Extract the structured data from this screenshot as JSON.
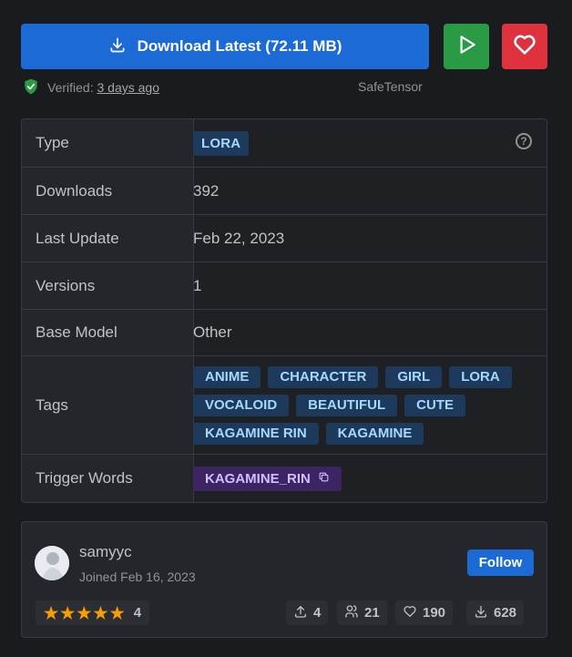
{
  "actions": {
    "download_label": "Download Latest (72.11 MB)",
    "play_icon": "play-icon",
    "like_icon": "heart-icon"
  },
  "verification": {
    "prefix": "Verified:",
    "date": "3 days ago",
    "format": "SafeTensor"
  },
  "details": {
    "type": {
      "label": "Type",
      "value": "LORA"
    },
    "downloads": {
      "label": "Downloads",
      "value": "392"
    },
    "last_update": {
      "label": "Last Update",
      "value": "Feb 22, 2023"
    },
    "versions": {
      "label": "Versions",
      "value": "1"
    },
    "base_model": {
      "label": "Base Model",
      "value": "Other"
    },
    "tags": {
      "label": "Tags",
      "values": [
        "ANIME",
        "CHARACTER",
        "GIRL",
        "LORA",
        "VOCALOID",
        "BEAUTIFUL",
        "CUTE",
        "KAGAMINE RIN",
        "KAGAMINE"
      ]
    },
    "trigger_words": {
      "label": "Trigger Words",
      "value": "KAGAMINE_RIN"
    }
  },
  "creator": {
    "username": "samyyc",
    "joined": "Joined Feb 16, 2023",
    "follow_label": "Follow",
    "rating": "4",
    "stars": 5,
    "stats": {
      "uploads": "4",
      "followers": "21",
      "likes": "190",
      "downloads": "628"
    }
  },
  "colors": {
    "primary": "#1c6ad6",
    "success": "#2b9a45",
    "danger": "#e0313e",
    "tag_bg": "#1d3a5c",
    "trigger_bg": "#3d2563",
    "star": "#f59f00"
  }
}
